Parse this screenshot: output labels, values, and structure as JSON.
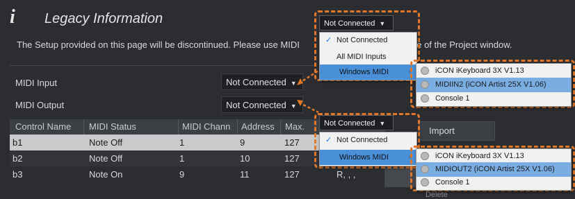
{
  "header": {
    "title": "Legacy Information",
    "message_left": "The Setup provided on this page will be discontinued. Please use MIDI",
    "message_right": "ne of the Project window."
  },
  "midi_input": {
    "label": "MIDI Input",
    "value": "Not Connected"
  },
  "midi_output": {
    "label": "MIDI Output",
    "value": "Not Connected"
  },
  "table": {
    "columns": [
      "Control Name",
      "MIDI Status",
      "MIDI Chann",
      "Address",
      "Max."
    ],
    "rows": [
      {
        "name": "b1",
        "status": "Note Off",
        "channel": "1",
        "address": "9",
        "max": "127",
        "extra": ""
      },
      {
        "name": "b2",
        "status": "Note Off",
        "channel": "1",
        "address": "10",
        "max": "127",
        "extra": ""
      },
      {
        "name": "b3",
        "status": "Note On",
        "channel": "9",
        "address": "11",
        "max": "127",
        "extra": "R, , ,"
      }
    ]
  },
  "buttons": {
    "import": "Import",
    "delete": "Delete"
  },
  "input_popup": {
    "header": "Not Connected",
    "items": [
      "Not Connected",
      "All MIDI Inputs",
      "Windows MIDI"
    ],
    "submenu": [
      "iCON iKeyboard 3X V1.13",
      "MIDIIN2 (iCON Artist 25X V1.06)",
      "Console 1"
    ]
  },
  "output_popup": {
    "header": "Not Connected",
    "items": [
      "Not Connected",
      "Windows MIDI"
    ],
    "submenu": [
      "iCON iKeyboard 3X V1.13",
      "MIDIOUT2 (iCON Artist 25X V1.06)",
      "Console 1"
    ]
  },
  "colors": {
    "highlight_orange": "#e0772a",
    "menu_highlight": "#4a90d9"
  }
}
